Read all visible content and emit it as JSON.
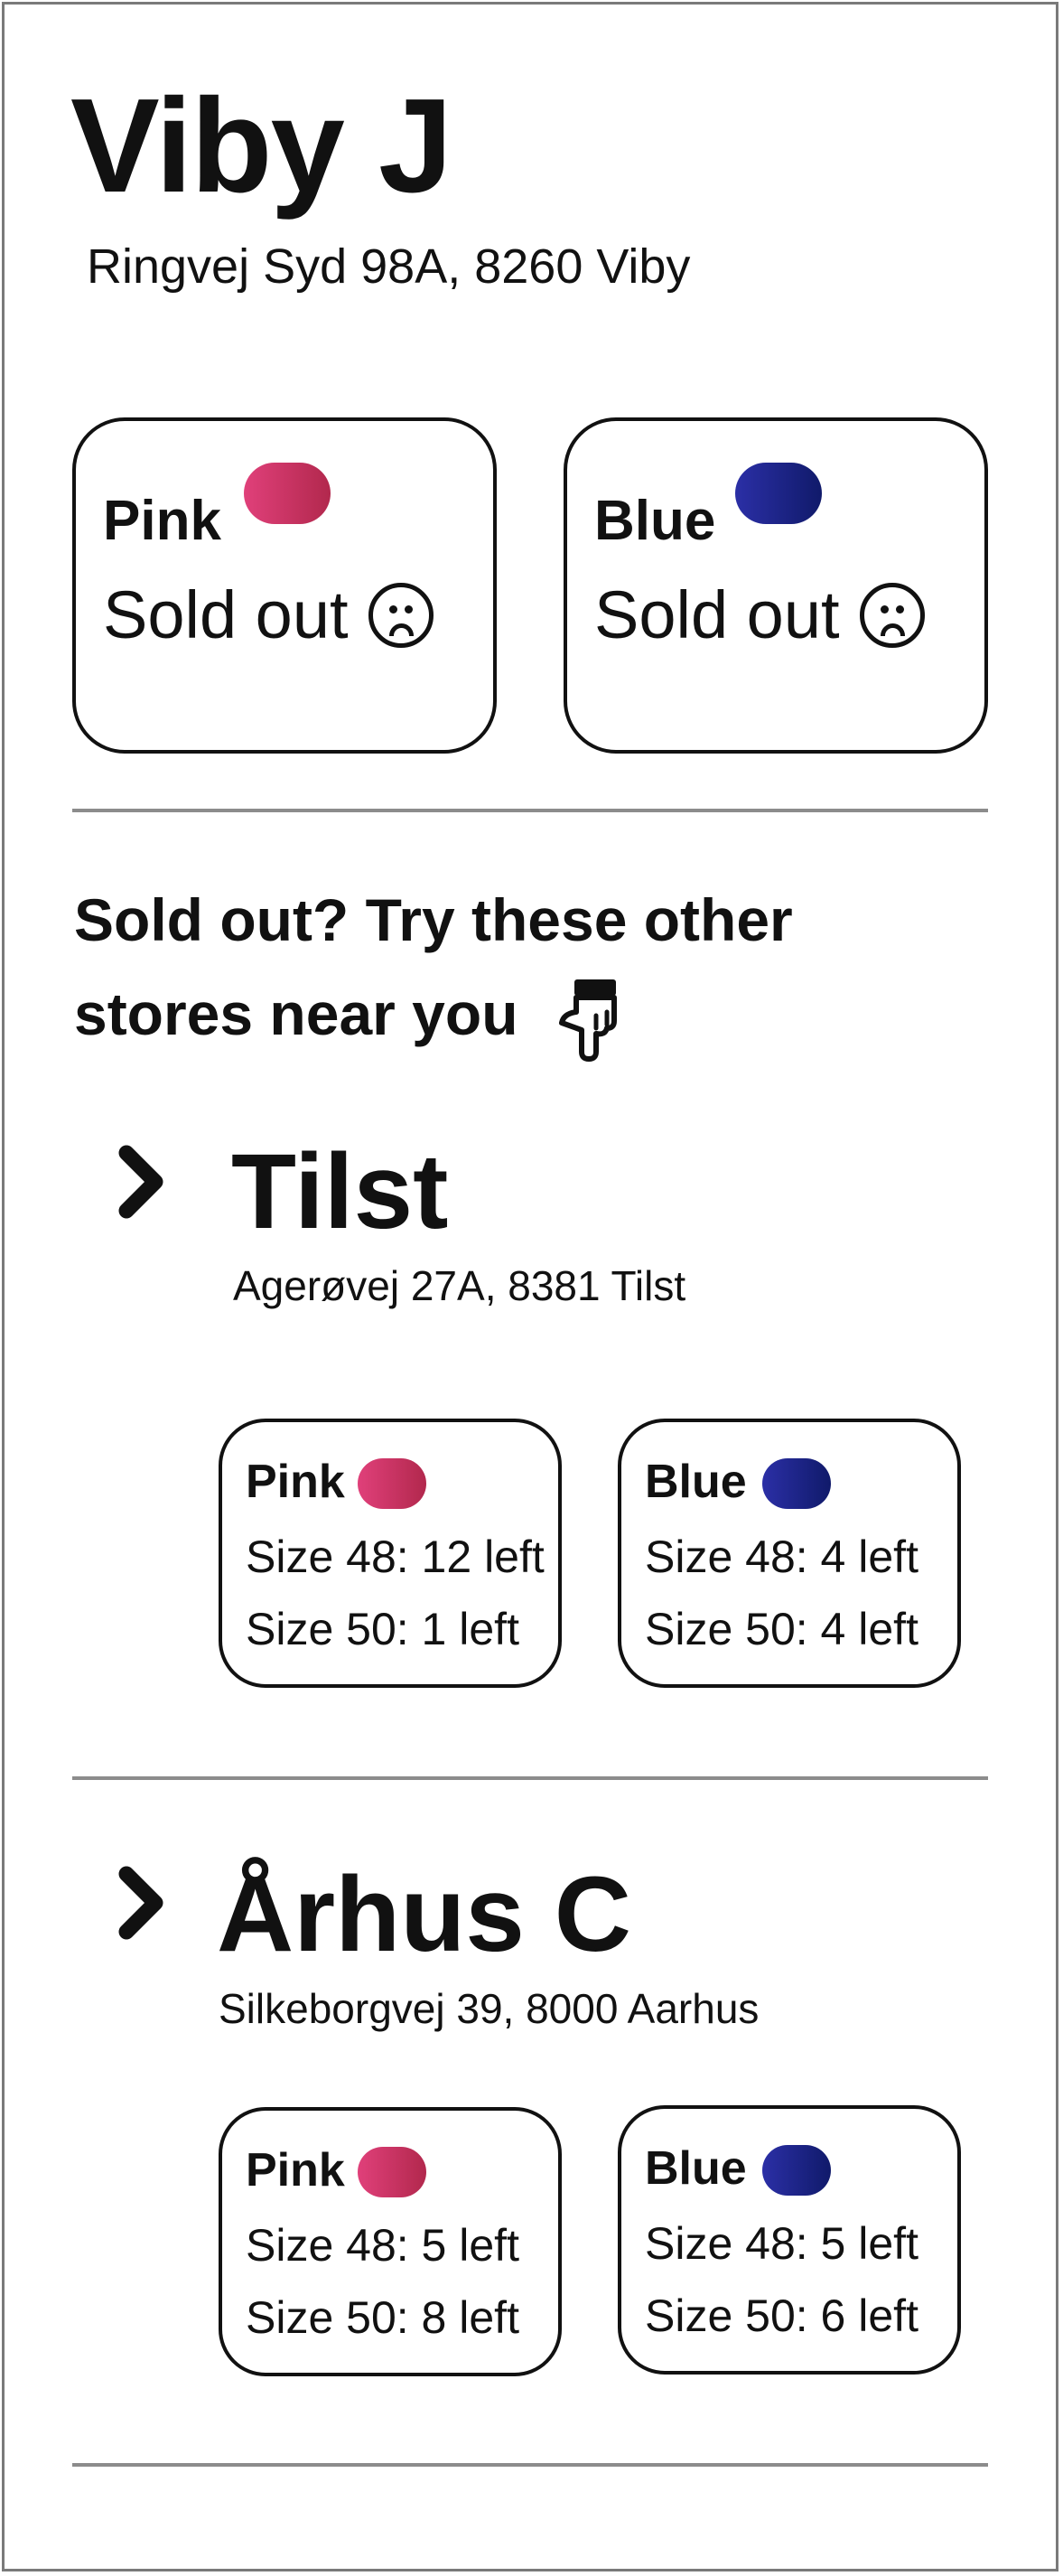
{
  "store": {
    "title": "Viby J",
    "address": "Ringvej Syd 98A, 8260 Viby",
    "colors": [
      {
        "name": "Pink",
        "status": "Sold out",
        "swatch": [
          "#e0407a",
          "#b2284d"
        ]
      },
      {
        "name": "Blue",
        "status": "Sold out",
        "swatch": [
          "#2b2fa6",
          "#101a6a"
        ]
      }
    ]
  },
  "nearby": {
    "heading_line1": "Sold out? Try these other",
    "heading_line2": "stores near you",
    "stores": [
      {
        "title": "Tilst",
        "address": "Agerøvej 27A, 8381 Tilst",
        "pink": {
          "name": "Pink",
          "size48": "Size 48: 12 left",
          "size50": "Size 50: 1 left"
        },
        "blue": {
          "name": "Blue",
          "size48": "Size 48: 4 left",
          "size50": "Size 50: 4 left"
        }
      },
      {
        "title": "Århus C",
        "address": "Silkeborgvej 39, 8000 Aarhus",
        "pink": {
          "name": "Pink",
          "size48": "Size 48: 5 left",
          "size50": "Size 50: 8 left"
        },
        "blue": {
          "name": "Blue",
          "size48": "Size 48: 5 left",
          "size50": "Size 50: 6 left"
        }
      }
    ]
  },
  "icons": {
    "sold_out": "sad-face-icon",
    "heading": "pointing-down-hand-icon",
    "expand": "chevron-right-icon"
  }
}
